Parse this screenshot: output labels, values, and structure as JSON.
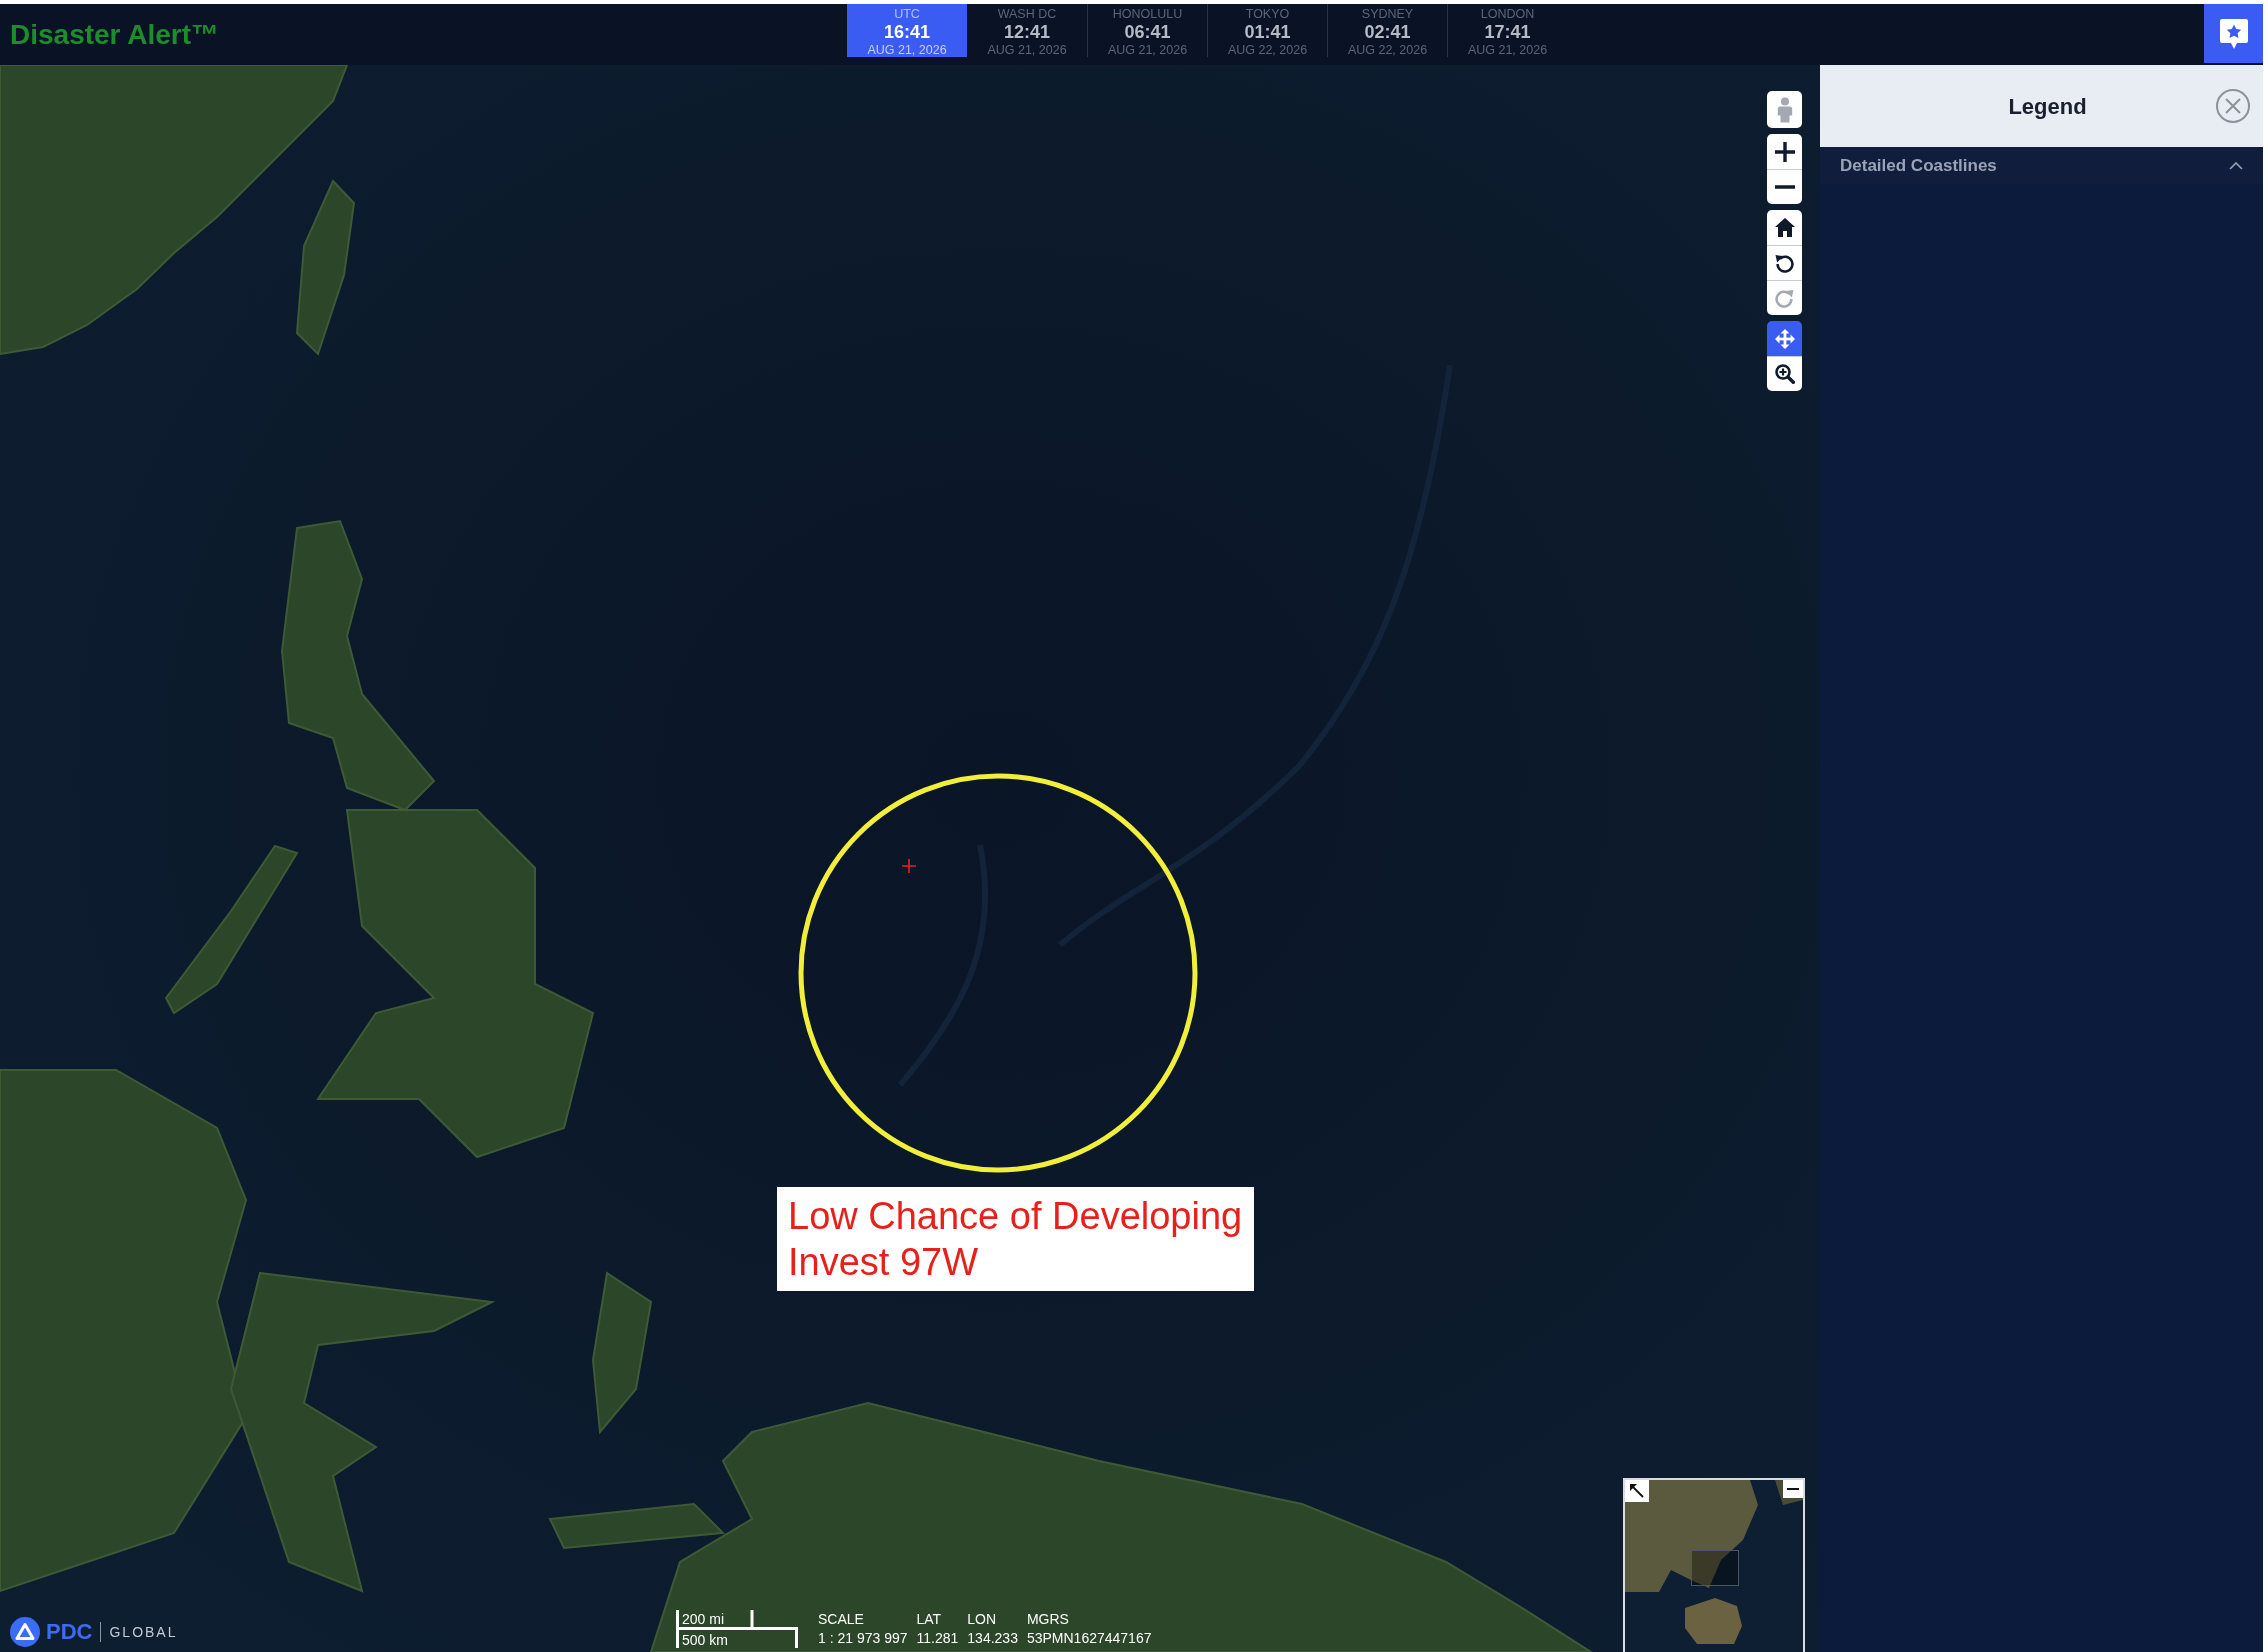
{
  "header": {
    "app_title": "Disaster Alert™"
  },
  "time_zones": [
    {
      "city": "UTC",
      "time": "16:41",
      "date": "AUG 21, 2026",
      "selected": true
    },
    {
      "city": "WASH DC",
      "time": "12:41",
      "date": "AUG 21, 2026",
      "selected": false
    },
    {
      "city": "HONOLULU",
      "time": "06:41",
      "date": "AUG 21, 2026",
      "selected": false
    },
    {
      "city": "TOKYO",
      "time": "01:41",
      "date": "AUG 22, 2026",
      "selected": false
    },
    {
      "city": "SYDNEY",
      "time": "02:41",
      "date": "AUG 22, 2026",
      "selected": false
    },
    {
      "city": "LONDON",
      "time": "17:41",
      "date": "AUG 21, 2026",
      "selected": false
    }
  ],
  "map_controls": [
    {
      "buttons": [
        {
          "kind": "street-view",
          "disabled": true
        }
      ]
    },
    {
      "buttons": [
        {
          "kind": "zoom-in",
          "disabled": false
        },
        {
          "kind": "zoom-out",
          "disabled": false
        }
      ]
    },
    {
      "buttons": [
        {
          "kind": "home",
          "disabled": false
        },
        {
          "kind": "rotate-left",
          "disabled": false
        },
        {
          "kind": "rotate-right",
          "disabled": true
        }
      ]
    },
    {
      "buttons": [
        {
          "kind": "pan",
          "selected": true
        },
        {
          "kind": "zoom-box",
          "selected": false
        }
      ]
    }
  ],
  "storm": {
    "status": "Low Chance of Developing",
    "name": "Invest 97W"
  },
  "logo": {
    "brand": "PDC",
    "tagline": "GLOBAL"
  },
  "scale_bar": {
    "imperial": "200 mi",
    "metric": "500 km"
  },
  "readouts": [
    {
      "label": "SCALE",
      "value": "1 : 21 973 997"
    },
    {
      "label": "LAT",
      "value": "11.281"
    },
    {
      "label": "LON",
      "value": "134.233"
    },
    {
      "label": "MGRS",
      "value": "53PMN1627447167"
    }
  ],
  "legend": {
    "title": "Legend",
    "sections": [
      {
        "title": "Detailed Coastlines",
        "expanded": true
      }
    ]
  }
}
